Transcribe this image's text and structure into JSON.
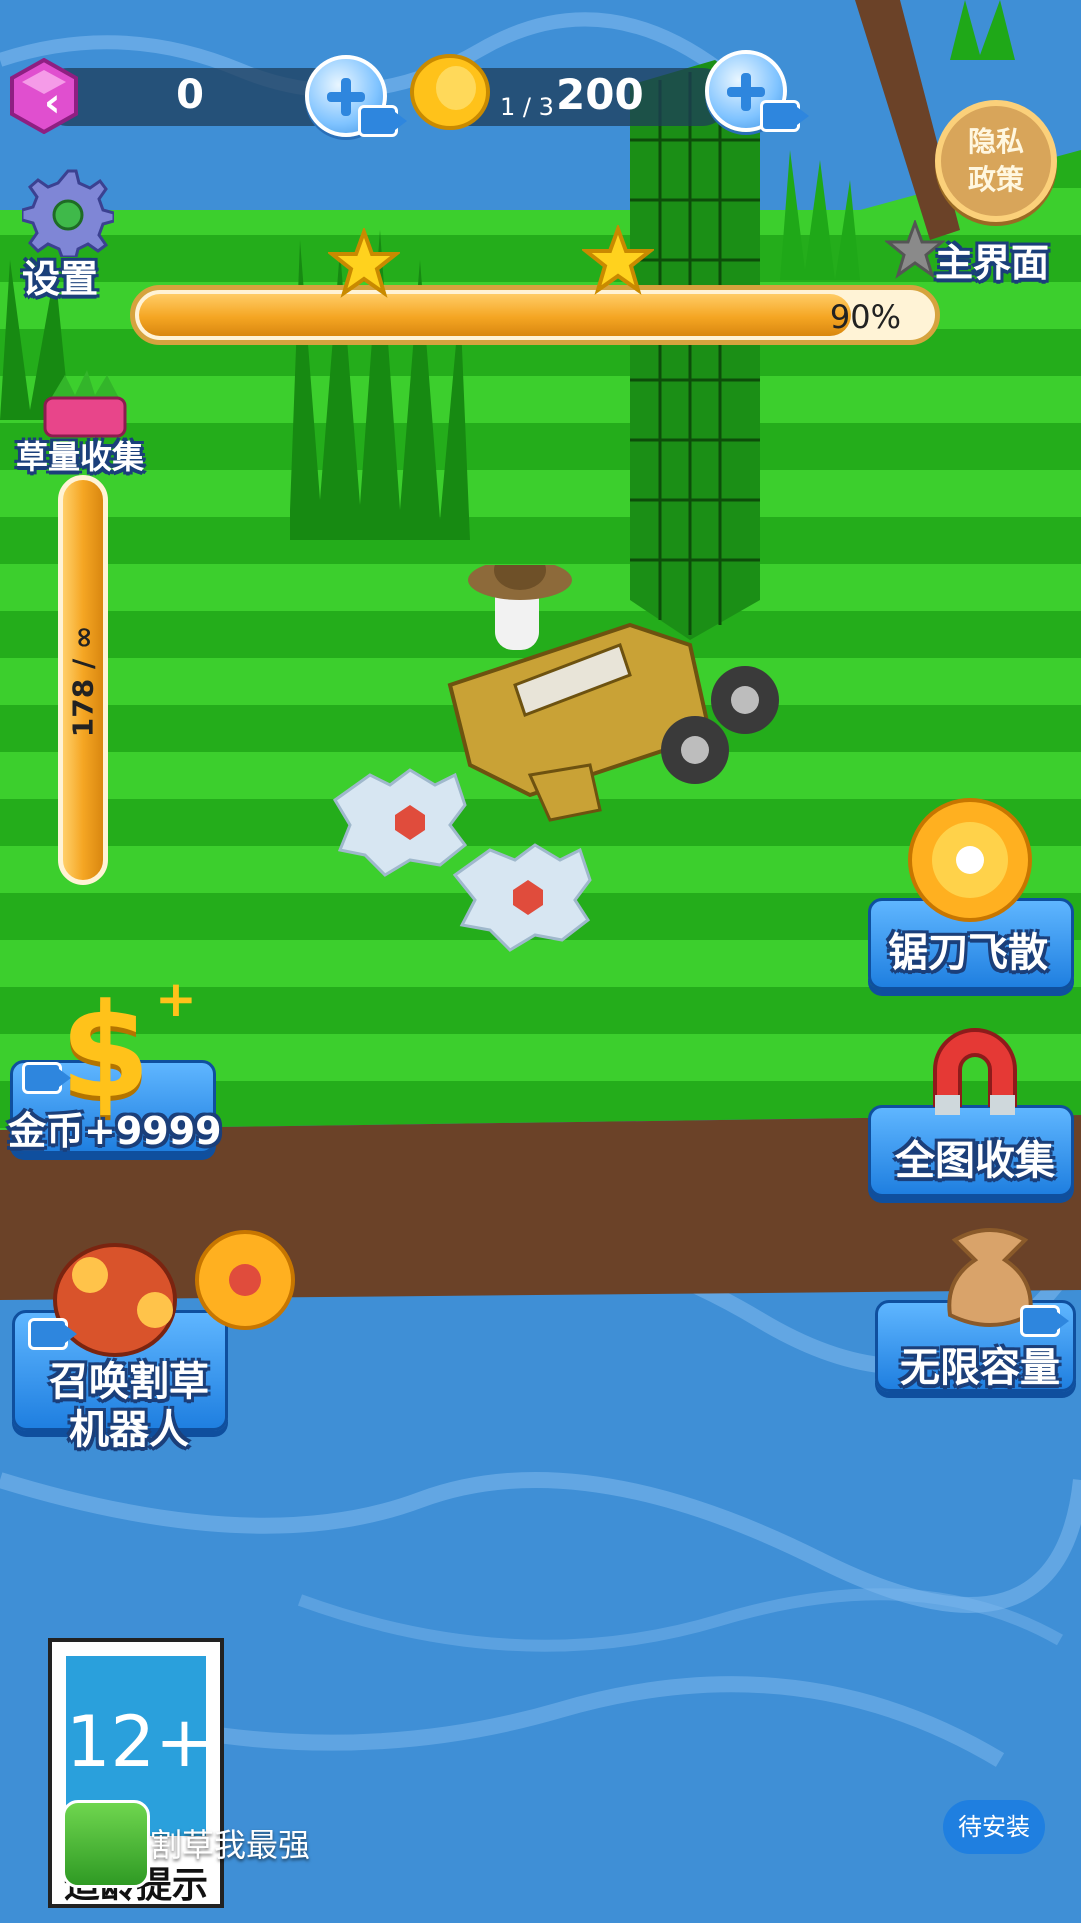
{
  "currency": {
    "gems_value": "0",
    "coins_value": "200",
    "level_progress": "1 / 3"
  },
  "top_right": {
    "privacy_label": "隐私\n政策",
    "main_menu_label": "主界面"
  },
  "settings_label": "设置",
  "progress": {
    "percent_text": "90%",
    "fraction": 0.9
  },
  "grass_collect": {
    "title": "草量收集",
    "counter": "178 / ∞"
  },
  "powerups": {
    "saw_fly": "锯刀飞散",
    "map_collect": "全图收集",
    "unlimited_capacity": "无限容量",
    "coins_bonus": "金币+9999",
    "summon_robot": "召唤割草\n机器人"
  },
  "age_rating": {
    "number": "12+",
    "caption": "适龄提示"
  },
  "app_banner": {
    "app_name": "割草我最强",
    "install_button": "待安装"
  },
  "colors": {
    "grass_light": "#36c928",
    "grass_dark": "#23a81a",
    "water": "#3f8fd6",
    "dirt": "#6b4228",
    "progress_orange": "#f5a623",
    "button_blue": "#1f7fe0"
  }
}
